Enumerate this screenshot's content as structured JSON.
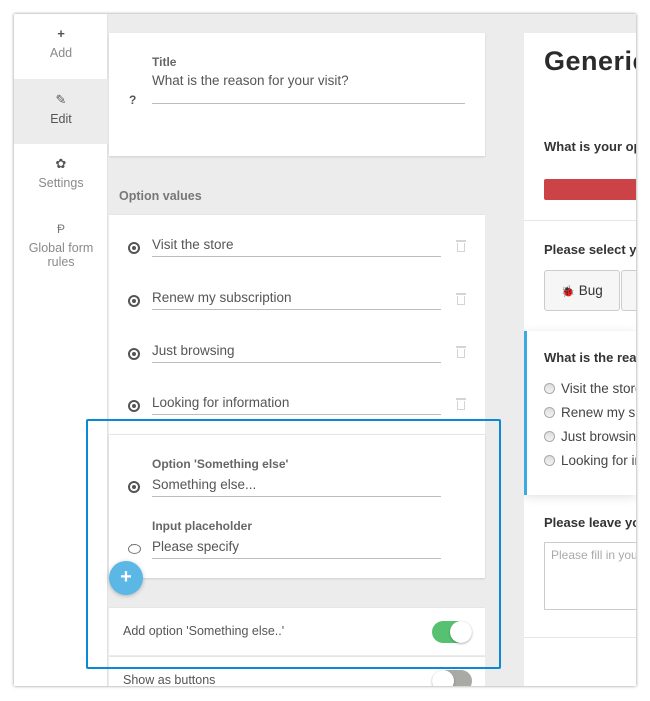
{
  "nav": {
    "items": [
      {
        "icon": "plus-icon",
        "glyph": "+",
        "label": "Add",
        "active": false
      },
      {
        "icon": "pencil-icon",
        "glyph": "✎",
        "label": "Edit",
        "active": true
      },
      {
        "icon": "gear-icon",
        "glyph": "✿",
        "label": "Settings",
        "active": false
      },
      {
        "icon": "rules-icon",
        "glyph": "Ᵽ",
        "label": "Global form rules",
        "active": false
      }
    ]
  },
  "editor": {
    "title_card": {
      "question_mark": "?",
      "label": "Title",
      "value": "What is the reason for your visit?"
    },
    "option_values_heading": "Option values",
    "options": [
      {
        "value": "Visit the store"
      },
      {
        "value": "Renew my subscription"
      },
      {
        "value": "Just browsing"
      },
      {
        "value": "Looking for information"
      }
    ],
    "something_else": {
      "option_label": "Option 'Something else'",
      "option_value": "Something else...",
      "placeholder_label": "Input placeholder",
      "placeholder_value": "Please specify"
    },
    "add_button_glyph": "+",
    "toggles": [
      {
        "label": "Add option 'Something else..'",
        "on": true
      },
      {
        "label": "Show as buttons",
        "on": false
      }
    ]
  },
  "preview": {
    "title": "Generic feedback",
    "question1": "What is your opinion",
    "question2": "Please select your feedback category",
    "category_buttons": [
      {
        "icon": "bug-icon",
        "glyph": "🐞",
        "label": "Bug"
      },
      {
        "label": ""
      }
    ],
    "active_question": {
      "title": "What is the reason for your visit?",
      "options": [
        "Visit the store",
        "Renew my subscription",
        "Just browsing",
        "Looking for information"
      ]
    },
    "question3": "Please leave your feedback",
    "textarea_placeholder": "Please fill in your feedback"
  },
  "colors": {
    "accent_blue": "#5bb8e6",
    "highlight_border": "#0a8ad6",
    "toggle_on": "#56c271",
    "toggle_off": "#a9a9a5",
    "rating_bar": "#cc4347",
    "active_question_bar": "#3ea9e0"
  }
}
